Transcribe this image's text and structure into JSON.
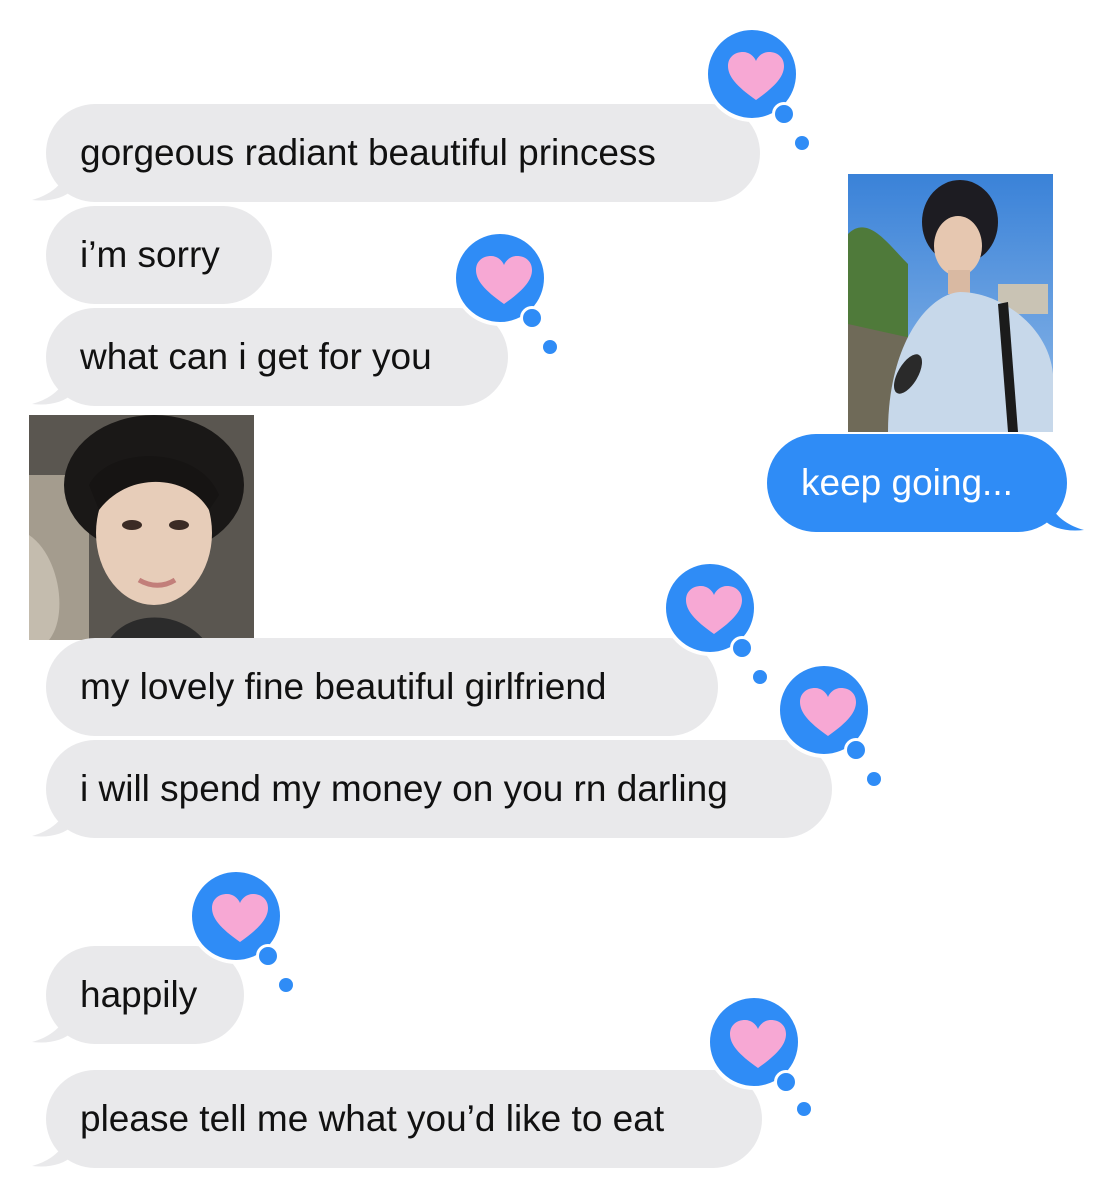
{
  "thread": {
    "messages": [
      {
        "id": "m1",
        "direction": "received",
        "text": "gorgeous radiant beautiful princess",
        "reaction": "heart"
      },
      {
        "id": "m2",
        "direction": "received",
        "text": "i’m sorry"
      },
      {
        "id": "m3",
        "direction": "received",
        "text": "what can i get for you",
        "reaction": "heart"
      },
      {
        "id": "p1",
        "direction": "sent",
        "type": "photo",
        "description": "selfie photo"
      },
      {
        "id": "m4",
        "direction": "sent",
        "text": "keep going..."
      },
      {
        "id": "p2",
        "direction": "received",
        "type": "photo",
        "description": "selfie photo"
      },
      {
        "id": "m5",
        "direction": "received",
        "text": "my lovely fine beautiful girlfriend",
        "reaction": "heart"
      },
      {
        "id": "m6",
        "direction": "received",
        "text": "i will spend my money on you rn darling",
        "reaction": "heart"
      },
      {
        "id": "m7",
        "direction": "received",
        "text": "happily",
        "reaction": "heart"
      },
      {
        "id": "m8",
        "direction": "received",
        "text": "please tell me what you’d like to eat",
        "reaction": "heart"
      }
    ]
  },
  "colors": {
    "received_bubble": "#e9e9eb",
    "sent_bubble": "#2f8cf6",
    "tapback": "#2f8cf6",
    "heart": "#f7a8d4"
  },
  "icons": {
    "reaction": "heart-icon"
  }
}
